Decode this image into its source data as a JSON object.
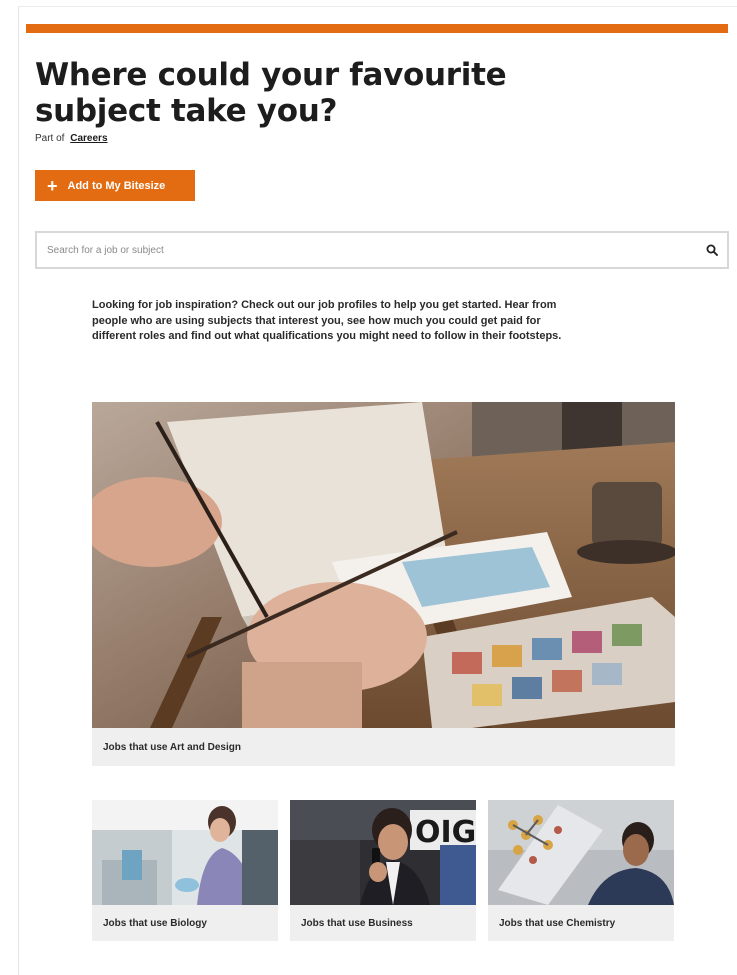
{
  "header": {
    "accent_color": "#e36c12",
    "title": "Where could your favourite subject take you?",
    "part_of_prefix": "Part of",
    "part_of_link": "Careers"
  },
  "actions": {
    "add_label": "Add to My Bitesize",
    "add_icon": "plus-icon"
  },
  "search": {
    "placeholder": "Search for a job or subject",
    "value": "",
    "icon": "search-icon"
  },
  "intro_text": "Looking for job inspiration? Check out our job profiles to help you get started. Hear from people who are using subjects that interest you, see how much you could get paid for different roles and find out what qualifications you might need to follow in their footsteps.",
  "cards": {
    "featured": {
      "caption": "Jobs that use Art and Design"
    },
    "items": [
      {
        "caption": "Jobs that use Biology"
      },
      {
        "caption": "Jobs that use Business"
      },
      {
        "caption": "Jobs that use Chemistry"
      }
    ]
  }
}
